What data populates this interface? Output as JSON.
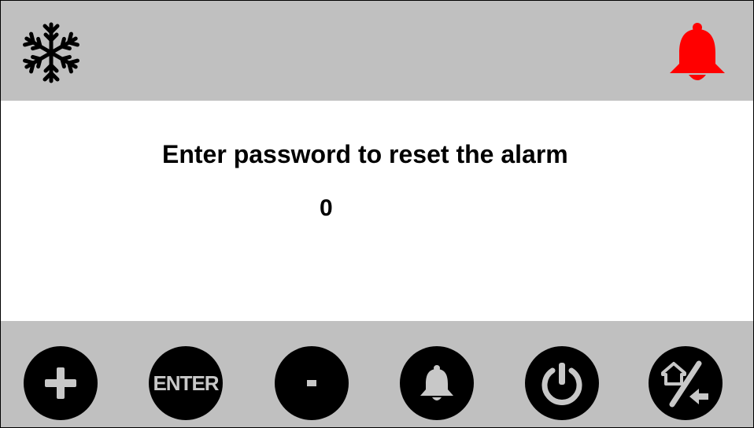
{
  "header": {
    "left_icon": "snowflake-icon",
    "right_icon": "bell-alarm-icon",
    "alarm_color": "#ff0000"
  },
  "main": {
    "prompt": "Enter password to reset the alarm",
    "password_value": "0"
  },
  "footer": {
    "buttons": [
      {
        "icon": "plus-icon"
      },
      {
        "icon": "enter-icon",
        "label": "ENTER"
      },
      {
        "icon": "minus-icon"
      },
      {
        "icon": "bell-icon"
      },
      {
        "icon": "power-icon"
      },
      {
        "icon": "home-back-icon"
      }
    ]
  },
  "colors": {
    "bar_background": "#c0c0c0",
    "button_fill": "#000000",
    "button_glyph": "#c8c8c8"
  }
}
